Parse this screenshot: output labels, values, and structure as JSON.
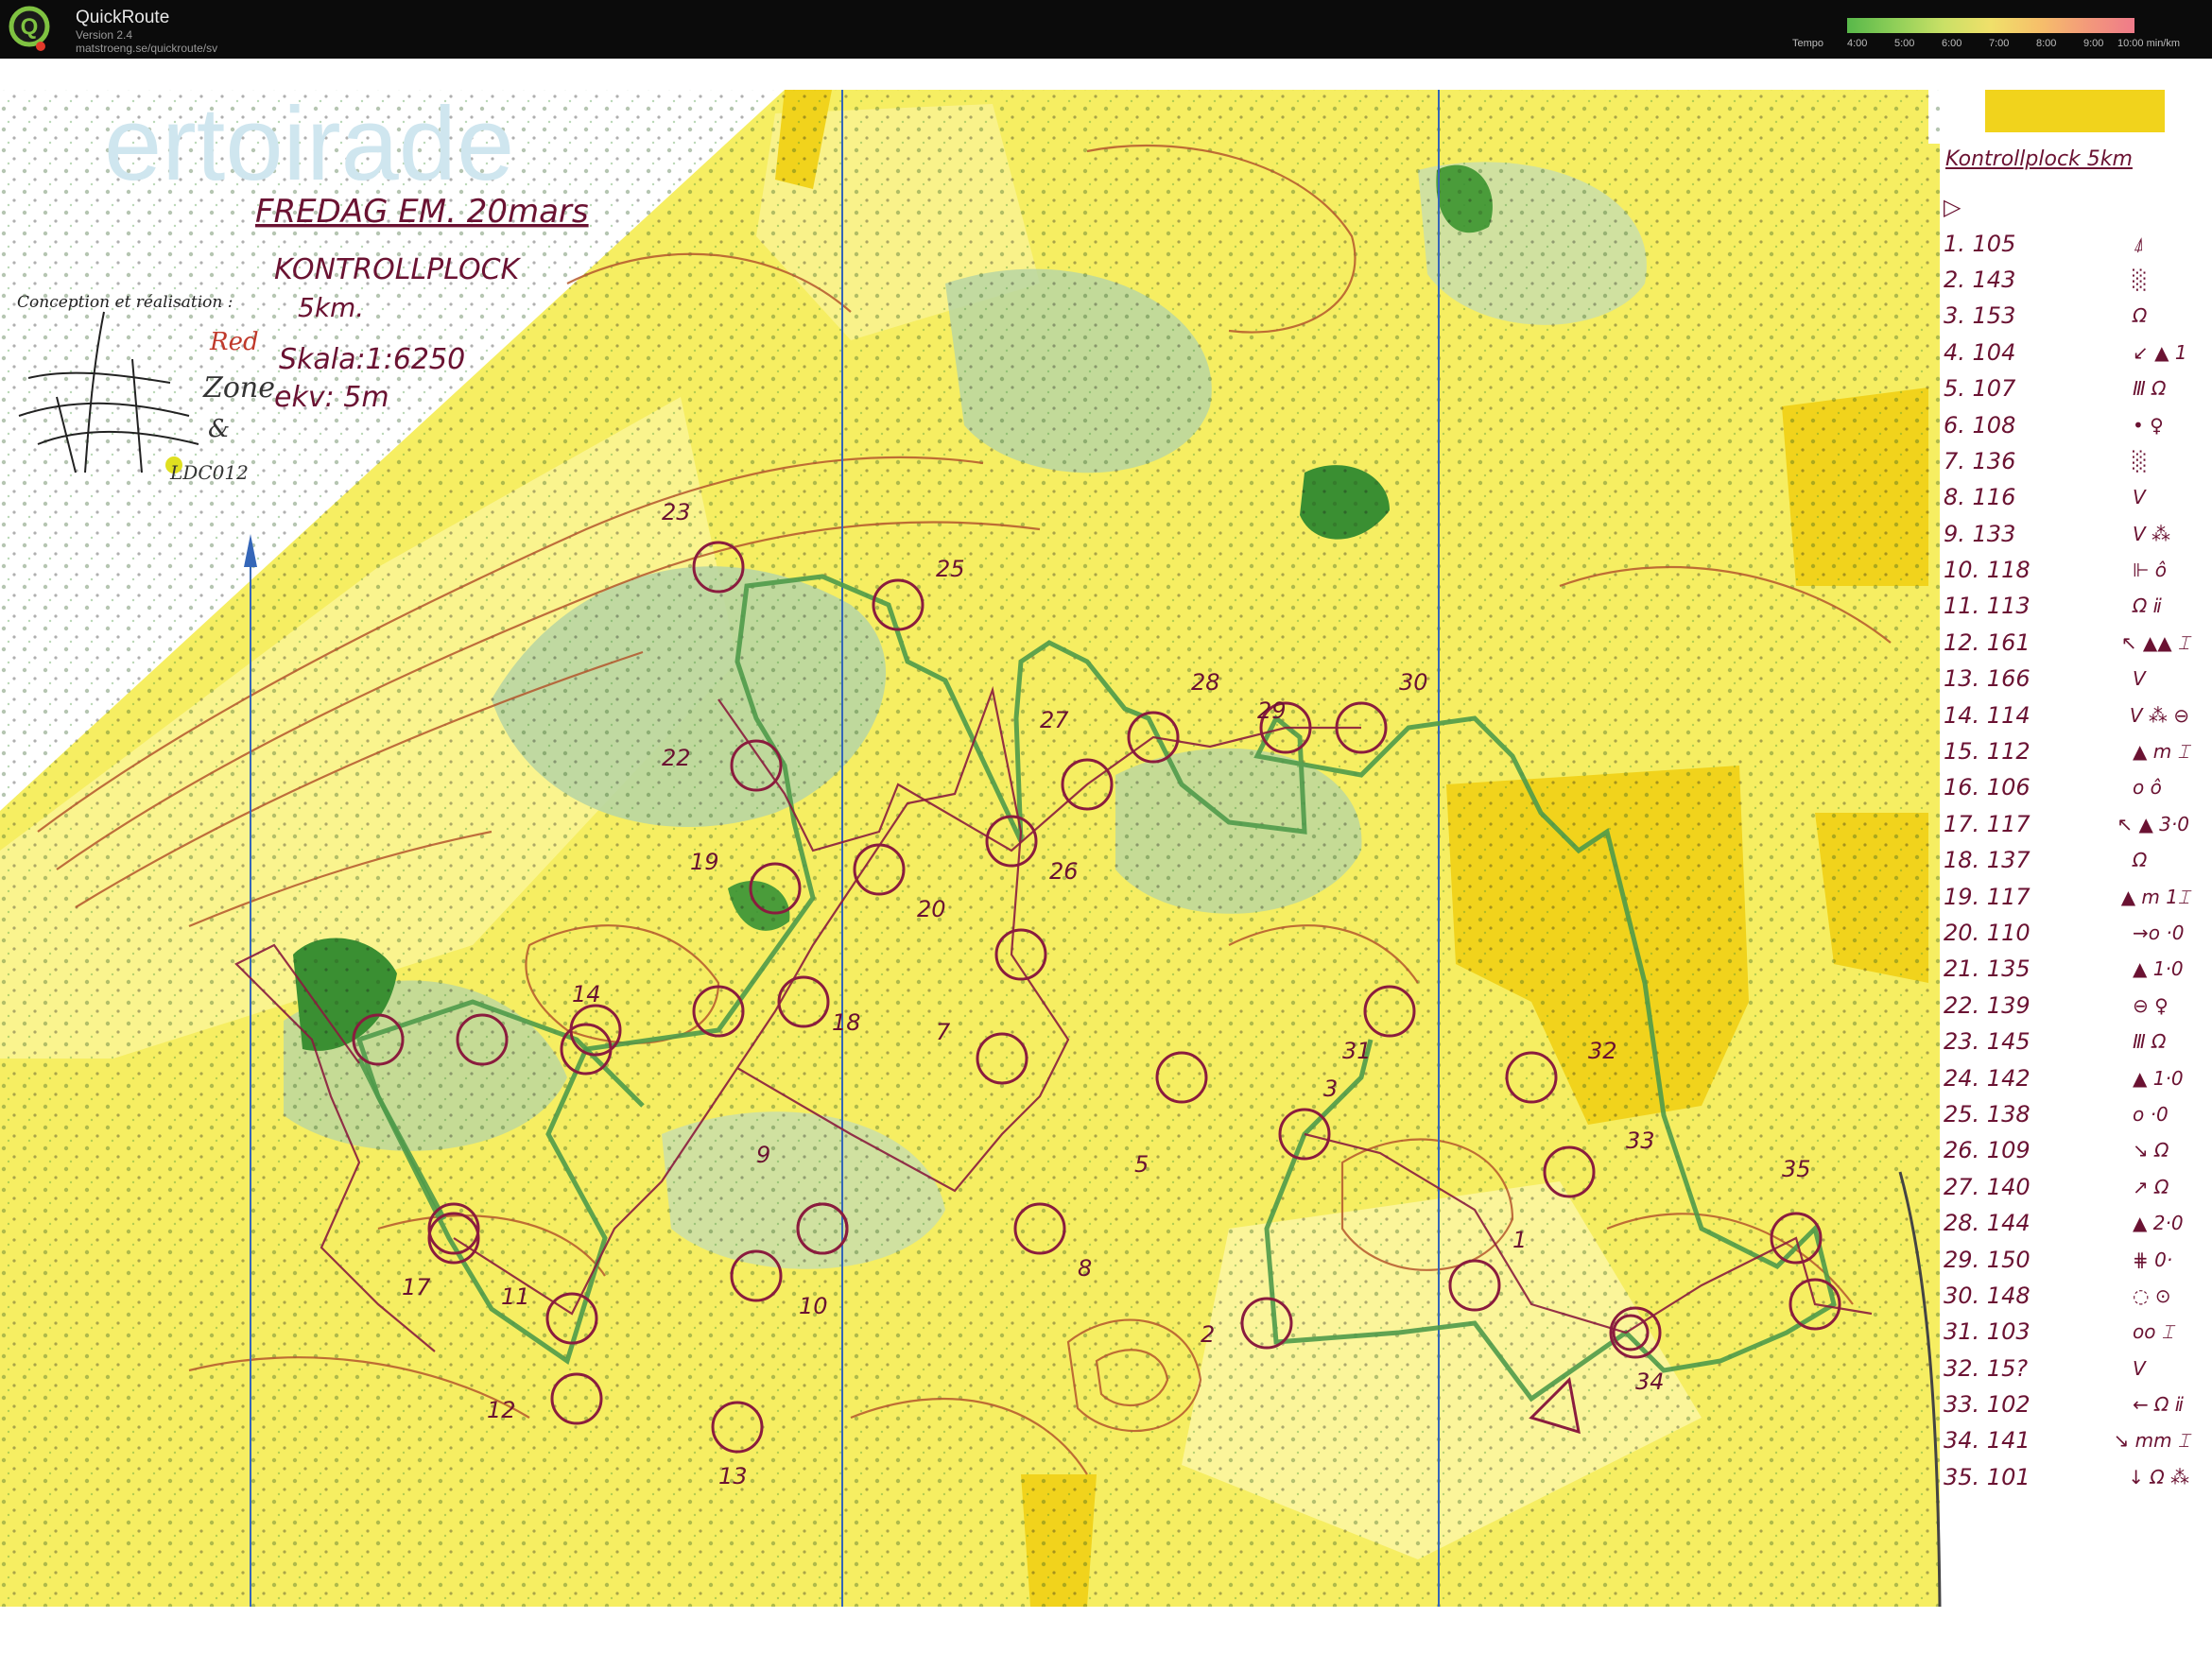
{
  "app": {
    "name": "QuickRoute",
    "version": "Version 2.4",
    "url": "matstroeng.se/quickroute/sv"
  },
  "tempo_scale": {
    "label": "Tempo",
    "ticks": [
      "4:00",
      "5:00",
      "6:00",
      "7:00",
      "8:00",
      "9:00",
      "10:00 min/km"
    ],
    "colors": [
      "#58b84a",
      "#8fcf58",
      "#c9e066",
      "#f0e06a",
      "#f6c06a",
      "#f39a7a",
      "#ef7a8a"
    ]
  },
  "map": {
    "watermark": "ertoirade",
    "header_lines": [
      "FREDAG EM. 20mars",
      "KONTROLLPLOCK",
      "5km.",
      "Skala:1:6250",
      "ekv: 5m"
    ],
    "credit": "Conception et réalisation :",
    "club_marks": [
      "Red",
      "Zone",
      "&",
      "LDC012"
    ],
    "colors": {
      "base": "#f6ee62",
      "open": "#fbf59a",
      "forest_light": "#b9d6a3",
      "forest_dark": "#3a8f32",
      "contour": "#b4562d",
      "control": "#8a1c3e",
      "route": "#4f9a4a",
      "magnetic_north": "#3466b8"
    },
    "control_numbers": [
      "1",
      "2",
      "3",
      "5",
      "7",
      "8",
      "9",
      "10",
      "11",
      "12",
      "13",
      "14",
      "17",
      "18",
      "19",
      "20",
      "22",
      "23",
      "25",
      "26",
      "27",
      "28",
      "29",
      "30",
      "31",
      "32",
      "33",
      "34",
      "35"
    ]
  },
  "descriptions": {
    "title": "Kontrollplock 5km",
    "start_symbol": "▷",
    "rows": [
      {
        "num": "1. 105",
        "sym": "⍋"
      },
      {
        "num": "2. 143",
        "sym": "░"
      },
      {
        "num": "3. 153",
        "sym": "Ω"
      },
      {
        "num": "4. 104",
        "sym": "↙ ▲ 1"
      },
      {
        "num": "5. 107",
        "sym": "Ⅲ Ω"
      },
      {
        "num": "6. 108",
        "sym": "•   ♀"
      },
      {
        "num": "7. 136",
        "sym": "░"
      },
      {
        "num": "8. 116",
        "sym": "V"
      },
      {
        "num": "9. 133",
        "sym": "V ⁂"
      },
      {
        "num": "10. 118",
        "sym": "⊩   ô"
      },
      {
        "num": "11. 113",
        "sym": "Ω   ⅱ"
      },
      {
        "num": "12. 161",
        "sym": "↖ ▲▲ ⌶"
      },
      {
        "num": "13. 166",
        "sym": "V"
      },
      {
        "num": "14. 114",
        "sym": "V ⁂ ⊖"
      },
      {
        "num": "15. 112",
        "sym": "▲ m ⌶"
      },
      {
        "num": "16. 106",
        "sym": "o   ô"
      },
      {
        "num": "17. 117",
        "sym": "↖ ▲ 3·0"
      },
      {
        "num": "18. 137",
        "sym": "Ω"
      },
      {
        "num": "19. 117",
        "sym": "▲ m 1⌶"
      },
      {
        "num": "20. 110",
        "sym": "→o  ·0"
      },
      {
        "num": "21. 135",
        "sym": "▲  1·0"
      },
      {
        "num": "22. 139",
        "sym": "⊖   ♀"
      },
      {
        "num": "23. 145",
        "sym": "Ⅲ Ω"
      },
      {
        "num": "24. 142",
        "sym": "▲  1·0"
      },
      {
        "num": "25. 138",
        "sym": "o   ·0"
      },
      {
        "num": "26. 109",
        "sym": "↘ Ω"
      },
      {
        "num": "27. 140",
        "sym": "↗ Ω"
      },
      {
        "num": "28. 144",
        "sym": "▲  2·0"
      },
      {
        "num": "29. 150",
        "sym": "⋕   0·"
      },
      {
        "num": "30. 148",
        "sym": "◌   ⊙"
      },
      {
        "num": "31. 103",
        "sym": "oo ⌶"
      },
      {
        "num": "32. 15?",
        "sym": "V"
      },
      {
        "num": "33. 102",
        "sym": "← Ω  ⅱ"
      },
      {
        "num": "34. 141",
        "sym": "↘ mm ⌶"
      },
      {
        "num": "35. 101",
        "sym": "↓ Ω ⁂"
      }
    ]
  }
}
